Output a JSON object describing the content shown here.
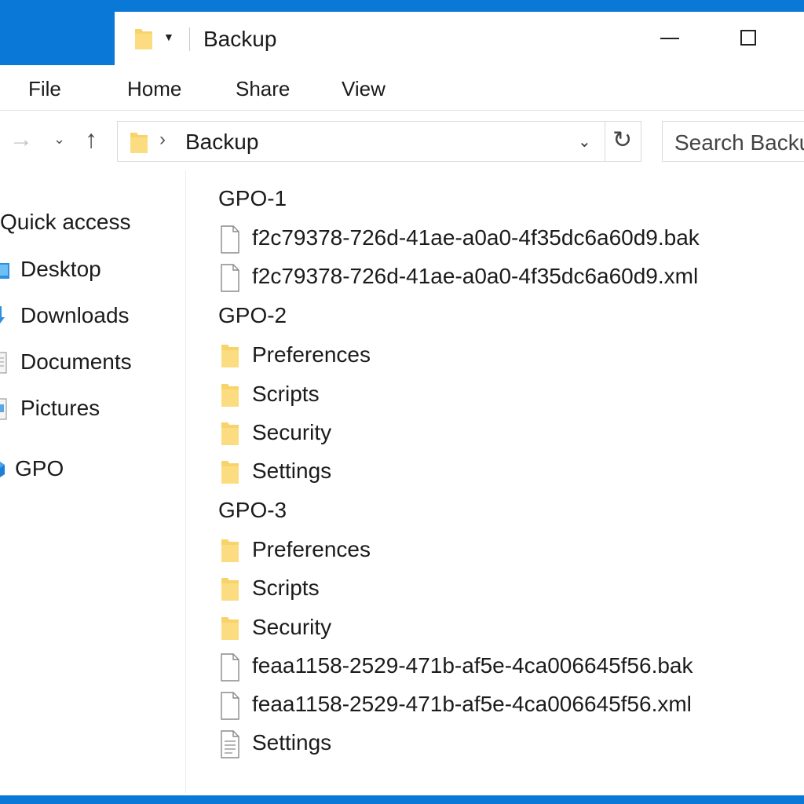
{
  "window": {
    "title": "Backup"
  },
  "ribbon": {
    "tabs": [
      "File",
      "Home",
      "Share",
      "View"
    ]
  },
  "address": {
    "crumb": "Backup",
    "search_placeholder": "Search Backup"
  },
  "nav": {
    "quick_access": "Quick access",
    "items": [
      "Desktop",
      "Downloads",
      "Documents",
      "Pictures"
    ],
    "gpo": "GPO"
  },
  "groups": [
    {
      "title": "GPO-1",
      "items": [
        {
          "name": "f2c79378-726d-41ae-a0a0-4f35dc6a60d9.bak",
          "icon": "file-icon"
        },
        {
          "name": "f2c79378-726d-41ae-a0a0-4f35dc6a60d9.xml",
          "icon": "file-icon"
        }
      ]
    },
    {
      "title": "GPO-2",
      "items": [
        {
          "name": "Preferences",
          "icon": "folder-icon"
        },
        {
          "name": "Scripts",
          "icon": "folder-icon"
        },
        {
          "name": "Security",
          "icon": "folder-icon"
        },
        {
          "name": "Settings",
          "icon": "folder-icon"
        }
      ]
    },
    {
      "title": "GPO-3",
      "items": [
        {
          "name": "Preferences",
          "icon": "folder-icon"
        },
        {
          "name": "Scripts",
          "icon": "folder-icon"
        },
        {
          "name": "Security",
          "icon": "folder-icon"
        },
        {
          "name": "feaa1158-2529-471b-af5e-4ca006645f56.bak",
          "icon": "file-icon"
        },
        {
          "name": "feaa1158-2529-471b-af5e-4ca006645f56.xml",
          "icon": "file-icon"
        },
        {
          "name": "Settings",
          "icon": "document-icon"
        }
      ]
    }
  ],
  "colors": {
    "accent": "#0a78d7",
    "folder": "#f8d36a"
  }
}
